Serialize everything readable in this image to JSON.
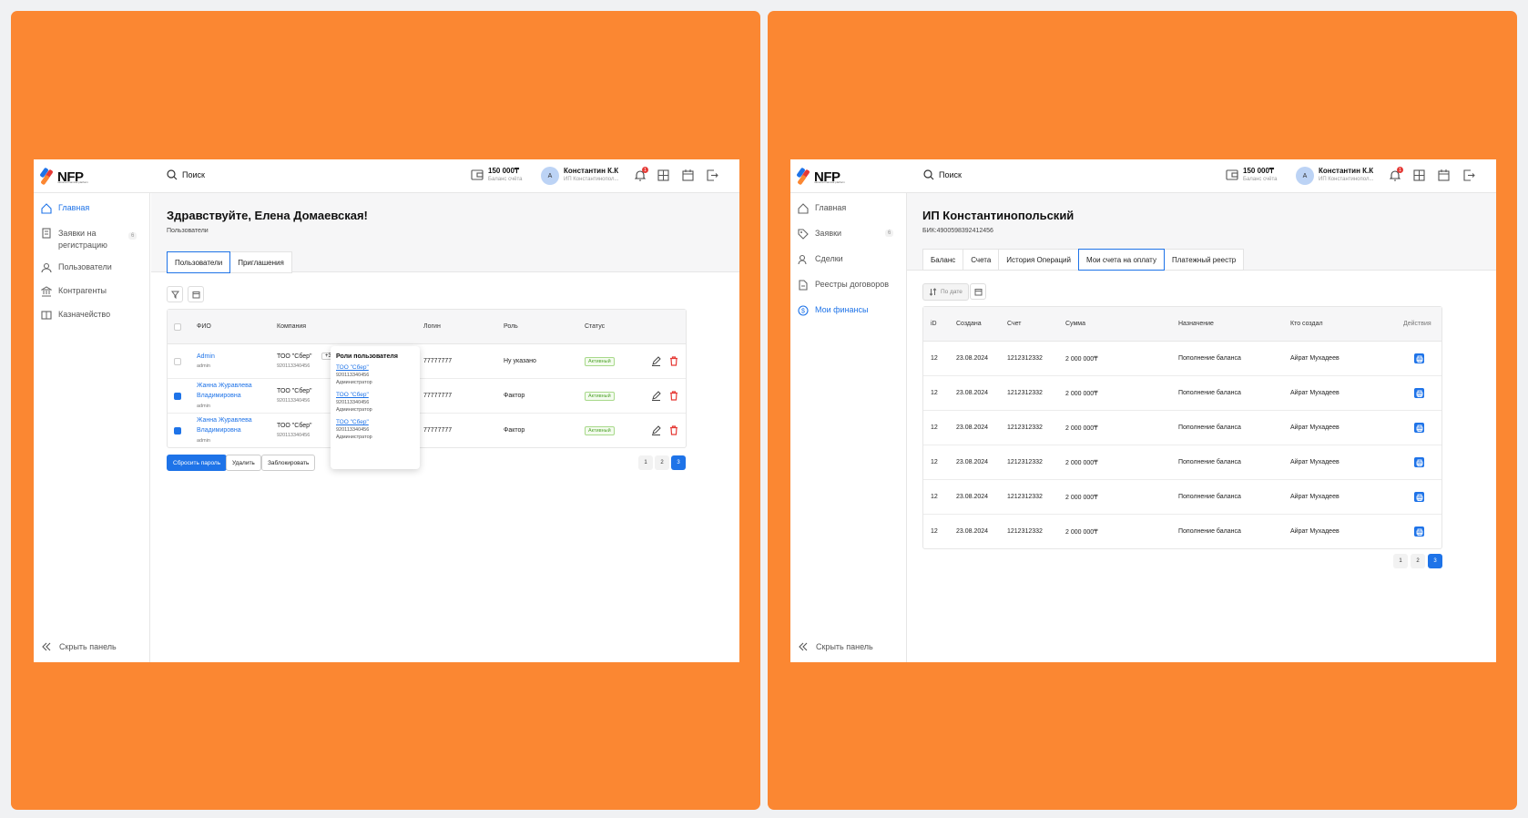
{
  "topbar": {
    "logo": "NFP",
    "logo_sub": "national financial platform",
    "search": "Поиск",
    "balance": "150 000₸",
    "balance_label": "Баланс счёта",
    "avatar": "А",
    "user_name": "Константин К.К",
    "user_company": "ИП Константинопол...",
    "notif_count": "1"
  },
  "left": {
    "sidebar": {
      "items": [
        {
          "label": "Главная"
        },
        {
          "label": "Заявки на регистрацию",
          "badge": "6"
        },
        {
          "label": "Пользователи"
        },
        {
          "label": "Контрагенты"
        },
        {
          "label": "Казначейство"
        }
      ],
      "hide": "Скрыть панель"
    },
    "title": "Здравствуйте, Елена Домаевская!",
    "breadcrumb": "Пользователи",
    "tabs": [
      "Пользователи",
      "Приглашения"
    ],
    "columns": [
      "ФИО",
      "Компания",
      "Логин",
      "Роль",
      "Статус"
    ],
    "rows": [
      {
        "name": "Admin",
        "name2": "",
        "login_sub": "admin",
        "company": "ТОО \"Сбер\"",
        "bin": "920113340456",
        "more": "+3",
        "login": "77777777",
        "role": "Ну указано",
        "status": "Активный",
        "checked": false
      },
      {
        "name": "Жанна Журавлева",
        "name2": "Владимировна",
        "login_sub": "admin",
        "company": "ТОО \"Сбер\"",
        "bin": "920113340456",
        "more": "",
        "login": "77777777",
        "role": "Фактор",
        "status": "Активный",
        "checked": true
      },
      {
        "name": "Жанна Журавлева",
        "name2": "Владимировна",
        "login_sub": "admin",
        "company": "ТОО \"Сбер\"",
        "bin": "920113340456",
        "more": "",
        "login": "77777777",
        "role": "Фактор",
        "status": "Активный",
        "checked": true
      }
    ],
    "popup": {
      "title": "Роли пользователя",
      "entries": [
        {
          "company": "ТОО \"Сбер\"",
          "bin": "920113340456",
          "role": "Администратор"
        },
        {
          "company": "ТОО \"Сбер\"",
          "bin": "920113340456",
          "role": "Администратор"
        },
        {
          "company": "ТОО \"Сбер\"",
          "bin": "920113340456",
          "role": "Администратор"
        }
      ]
    },
    "buttons": {
      "reset": "Сбросить пароль",
      "delete": "Удалить",
      "block": "Заблокировать"
    },
    "pages": [
      "1",
      "2",
      "3"
    ],
    "current_page": "3"
  },
  "right": {
    "sidebar": {
      "items": [
        {
          "label": "Главная"
        },
        {
          "label": "Заявки",
          "badge": "6"
        },
        {
          "label": "Сделки"
        },
        {
          "label": "Реестры договоров"
        },
        {
          "label": "Мои финансы"
        }
      ],
      "hide": "Скрыть панель"
    },
    "title": "ИП Константинопольский",
    "bik": "БИК:4900598392412456",
    "tabs": [
      "Баланс",
      "Счета",
      "История Операций",
      "Мои счета на оплату",
      "Платежный реестр"
    ],
    "active_tab": "Мои счета на оплату",
    "sort": "По дате",
    "columns": [
      "iD",
      "Создана",
      "Счет",
      "Сумма",
      "Назначение",
      "Кто создал",
      "Действия"
    ],
    "rows": [
      {
        "id": "12",
        "created": "23.08.2024",
        "account": "1212312332",
        "sum": "2 000 000₸",
        "purpose": "Пополнение баланса",
        "creator": "Айрат Мухадеев"
      },
      {
        "id": "12",
        "created": "23.08.2024",
        "account": "1212312332",
        "sum": "2 000 000₸",
        "purpose": "Пополнение баланса",
        "creator": "Айрат Мухадеев"
      },
      {
        "id": "12",
        "created": "23.08.2024",
        "account": "1212312332",
        "sum": "2 000 000₸",
        "purpose": "Пополнение баланса",
        "creator": "Айрат Мухадеев"
      },
      {
        "id": "12",
        "created": "23.08.2024",
        "account": "1212312332",
        "sum": "2 000 000₸",
        "purpose": "Пополнение баланса",
        "creator": "Айрат Мухадеев"
      },
      {
        "id": "12",
        "created": "23.08.2024",
        "account": "1212312332",
        "sum": "2 000 000₸",
        "purpose": "Пополнение баланса",
        "creator": "Айрат Мухадеев"
      },
      {
        "id": "12",
        "created": "23.08.2024",
        "account": "1212312332",
        "sum": "2 000 000₸",
        "purpose": "Пополнение баланса",
        "creator": "Айрат Мухадеев"
      }
    ],
    "pages": [
      "1",
      "2",
      "3"
    ],
    "current_page": "3"
  },
  "colors": {
    "accent": "#1e73e8",
    "background": "#fb8732",
    "danger": "#e53935",
    "success": "#52a52e"
  }
}
